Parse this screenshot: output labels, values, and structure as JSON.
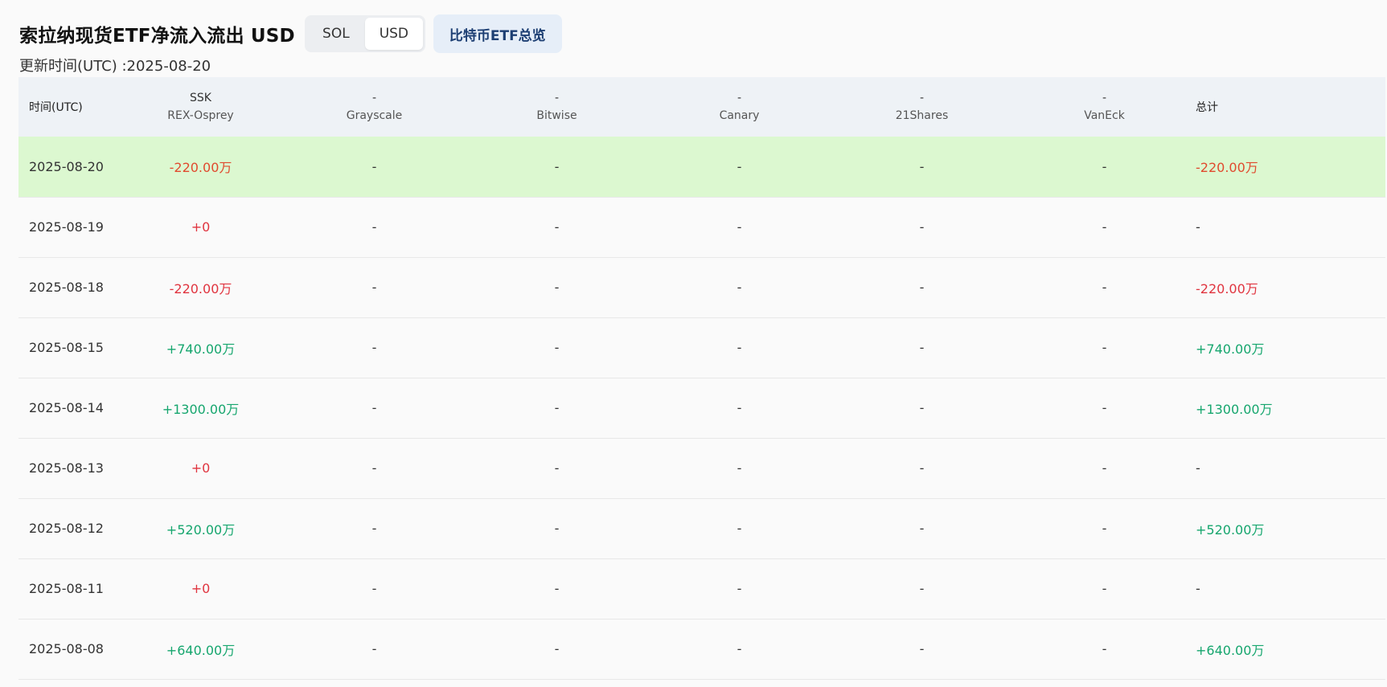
{
  "header": {
    "title": "索拉纳现货ETF净流入流出 USD",
    "toggle": [
      "SOL",
      "USD"
    ],
    "toggle_active": "USD",
    "overview_button": "比特币ETF总览",
    "updated": "更新时间(UTC) :2025-08-20"
  },
  "table": {
    "columns": [
      {
        "top": "",
        "bottom": "时间(UTC)"
      },
      {
        "top": "SSK",
        "bottom": "REX-Osprey"
      },
      {
        "top": "-",
        "bottom": "Grayscale"
      },
      {
        "top": "-",
        "bottom": "Bitwise"
      },
      {
        "top": "-",
        "bottom": "Canary"
      },
      {
        "top": "-",
        "bottom": "21Shares"
      },
      {
        "top": "-",
        "bottom": "VanEck"
      },
      {
        "top": "",
        "bottom": "总计"
      }
    ],
    "rows": [
      {
        "date": "2025-08-20",
        "ssk": "-220.00万",
        "ssk_sign": "neg",
        "grayscale": "-",
        "bitwise": "-",
        "canary": "-",
        "shares21": "-",
        "vaneck": "-",
        "total": "-220.00万",
        "total_sign": "neg",
        "highlight": true
      },
      {
        "date": "2025-08-19",
        "ssk": "+0",
        "ssk_sign": "zero",
        "grayscale": "-",
        "bitwise": "-",
        "canary": "-",
        "shares21": "-",
        "vaneck": "-",
        "total": "-",
        "total_sign": "none",
        "highlight": false
      },
      {
        "date": "2025-08-18",
        "ssk": "-220.00万",
        "ssk_sign": "zero",
        "grayscale": "-",
        "bitwise": "-",
        "canary": "-",
        "shares21": "-",
        "vaneck": "-",
        "total": "-220.00万",
        "total_sign": "zero",
        "highlight": false
      },
      {
        "date": "2025-08-15",
        "ssk": "+740.00万",
        "ssk_sign": "pos",
        "grayscale": "-",
        "bitwise": "-",
        "canary": "-",
        "shares21": "-",
        "vaneck": "-",
        "total": "+740.00万",
        "total_sign": "pos",
        "highlight": false
      },
      {
        "date": "2025-08-14",
        "ssk": "+1300.00万",
        "ssk_sign": "pos",
        "grayscale": "-",
        "bitwise": "-",
        "canary": "-",
        "shares21": "-",
        "vaneck": "-",
        "total": "+1300.00万",
        "total_sign": "pos",
        "highlight": false
      },
      {
        "date": "2025-08-13",
        "ssk": "+0",
        "ssk_sign": "zero",
        "grayscale": "-",
        "bitwise": "-",
        "canary": "-",
        "shares21": "-",
        "vaneck": "-",
        "total": "-",
        "total_sign": "none",
        "highlight": false
      },
      {
        "date": "2025-08-12",
        "ssk": "+520.00万",
        "ssk_sign": "pos",
        "grayscale": "-",
        "bitwise": "-",
        "canary": "-",
        "shares21": "-",
        "vaneck": "-",
        "total": "+520.00万",
        "total_sign": "pos",
        "highlight": false
      },
      {
        "date": "2025-08-11",
        "ssk": "+0",
        "ssk_sign": "zero",
        "grayscale": "-",
        "bitwise": "-",
        "canary": "-",
        "shares21": "-",
        "vaneck": "-",
        "total": "-",
        "total_sign": "none",
        "highlight": false
      },
      {
        "date": "2025-08-08",
        "ssk": "+640.00万",
        "ssk_sign": "pos",
        "grayscale": "-",
        "bitwise": "-",
        "canary": "-",
        "shares21": "-",
        "vaneck": "-",
        "total": "+640.00万",
        "total_sign": "pos",
        "highlight": false
      }
    ]
  },
  "colors": {
    "negative": "#e04a2e",
    "positive": "#16a66e",
    "zero": "#e0343f",
    "highlight_row": "#dcf8d0",
    "header_bg": "#eef2f6",
    "overview_bg": "#e6eef8"
  }
}
